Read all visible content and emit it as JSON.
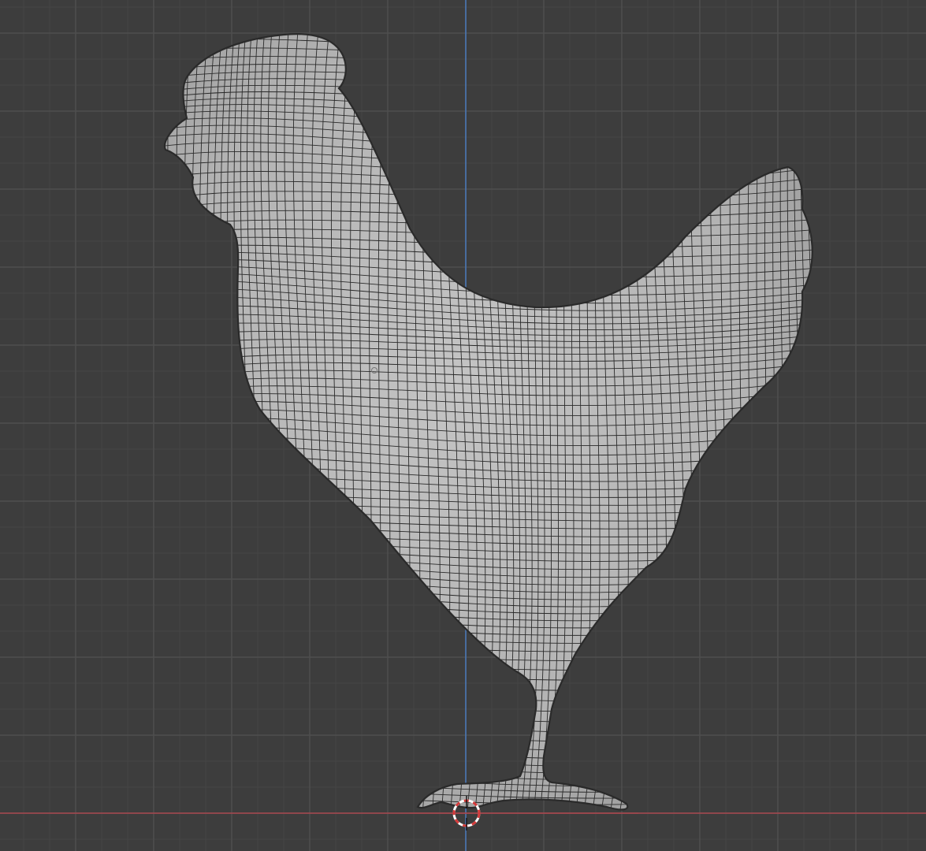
{
  "app": "3D viewport",
  "viewport": {
    "background_color": "#3d3d3d",
    "grid_minor_color": "#454545",
    "grid_major_color": "#4f4f4f",
    "x_axis_color": "#a8474f",
    "z_axis_color": "#4a77b4",
    "grid": true
  },
  "object": {
    "name": "rooster-mesh",
    "display": "wireframe-over-solid",
    "surface_color": "#b9b9b9",
    "wire_color": "#2a2a2a"
  },
  "cursor": {
    "icon": "3d-cursor-icon",
    "ring_colors": [
      "#ffffff",
      "#d43a3a"
    ]
  }
}
